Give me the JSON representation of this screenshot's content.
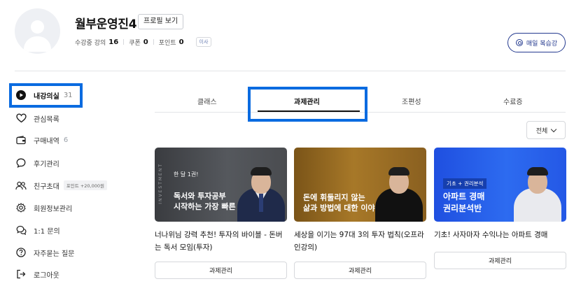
{
  "profile": {
    "username": "월부운영진4",
    "profile_button": "프로필 보기",
    "stats": [
      {
        "label": "수강중 강의",
        "value": "16"
      },
      {
        "label": "쿠폰",
        "value": "0"
      },
      {
        "label": "포인트",
        "value": "0"
      }
    ],
    "tag": "이사",
    "review_button": "매일 복습강"
  },
  "sidebar": {
    "items": [
      {
        "label": "내강의실",
        "count": "31",
        "icon": "play-circle-icon",
        "active": true
      },
      {
        "label": "관심목록",
        "icon": "heart-icon"
      },
      {
        "label": "구매내역",
        "count": "6",
        "icon": "wallet-icon"
      },
      {
        "label": "후기관리",
        "icon": "speech-bubble-icon"
      },
      {
        "label": "친구초대",
        "badge": "포인트 +20,000원",
        "icon": "users-icon"
      },
      {
        "label": "회원정보관리",
        "icon": "gear-icon"
      },
      {
        "label": "1:1 문의",
        "icon": "chat-icon"
      },
      {
        "label": "자주묻는 질문",
        "icon": "question-circle-icon"
      },
      {
        "label": "로그아웃",
        "icon": "logout-icon"
      }
    ]
  },
  "tabs": [
    {
      "label": "클래스"
    },
    {
      "label": "과제관리",
      "active": true
    },
    {
      "label": "조편성"
    },
    {
      "label": "수료증"
    }
  ],
  "filter": {
    "value": "전체"
  },
  "cards": [
    {
      "thumb_vertical": "INVESTMENT",
      "thumb_small": "한 달 1권!",
      "thumb_line1": "독서와 투자공부",
      "thumb_line2": "시작하는 가장 빠른 방법",
      "title": "너나위님 강력 추천! 투자의 바이블 - 돈버는 독서 모임(투자)",
      "button": "과제관리"
    },
    {
      "thumb_line1": "돈에 휘둘리지 않는",
      "thumb_line2": "삶과 방법에 대한 이야기",
      "title": "세상을 이기는 97대 3의 투자 법칙(오프라인강의)",
      "button": "과제관리"
    },
    {
      "thumb_tag": "기초 + 권리분석",
      "thumb_line1": "아파트 경매",
      "thumb_line2": "권리분석반",
      "title": "기초! 사자마자 수익나는 아파트 경매",
      "button": "과제관리"
    }
  ],
  "colors": {
    "accent": "#243a8f",
    "highlight": "#0a6be0"
  }
}
